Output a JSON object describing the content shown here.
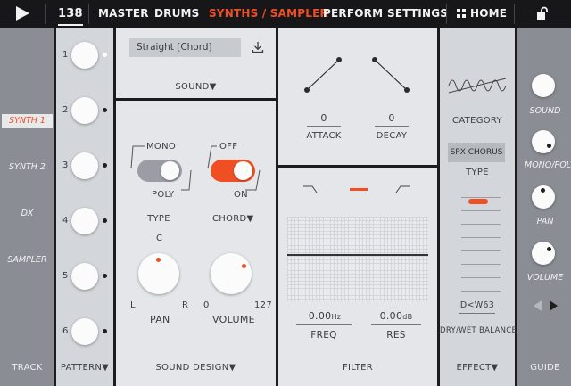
{
  "topbar": {
    "tempo": "138",
    "tabs": [
      "MASTER",
      "DRUMS",
      "SYNTHS / SAMPLER",
      "PERFORM",
      "SETTINGS"
    ],
    "home": "HOME",
    "active_tab": "SYNTHS / SAMPLER"
  },
  "track": {
    "items": [
      "SYNTH 1",
      "SYNTH 2",
      "DX",
      "SAMPLER"
    ],
    "footer": "TRACK"
  },
  "pattern": {
    "numbers": [
      "1",
      "2",
      "3",
      "4",
      "5",
      "6"
    ],
    "footer": "PATTERN▼"
  },
  "sound": {
    "preset": "Straight [Chord]",
    "label": "SOUND▼"
  },
  "sound_design": {
    "type_on": "MONO",
    "type_off": "POLY",
    "type_label": "TYPE",
    "chord_off": "OFF",
    "chord_on": "ON",
    "chord_label": "CHORD▼",
    "pan_top": "C",
    "pan_left": "L",
    "pan_right": "R",
    "pan_label": "PAN",
    "vol_min": "0",
    "vol_max": "127",
    "vol_label": "VOLUME",
    "footer": "SOUND DESIGN▼"
  },
  "envelope": {
    "attack_value": "0",
    "attack_label": "ATTACK",
    "decay_value": "0",
    "decay_label": "DECAY"
  },
  "filter": {
    "freq_value": "0.00",
    "freq_unit": "Hz",
    "freq_label": "FREQ",
    "res_value": "0.00",
    "res_unit": "dB",
    "res_label": "RES",
    "footer": "FILTER"
  },
  "effect": {
    "category_label": "CATEGORY",
    "type_value": "SPX CHORUS",
    "type_label": "TYPE",
    "balance_value": "D<W63",
    "balance_label": "DRY/WET BALANCE",
    "footer": "EFFECT▼"
  },
  "guide": {
    "items": [
      "SOUND",
      "MONO/POLY",
      "PAN",
      "VOLUME"
    ],
    "footer": "GUIDE"
  },
  "colors": {
    "accent": "#f04e23",
    "topbar_bg": "#17171a",
    "panel_dark": "#8a8e94",
    "panel_light": "#e4e6e9"
  },
  "icons": [
    "play-icon",
    "home-grid-icon",
    "unlock-icon",
    "download-icon",
    "sine-wave-icon",
    "triangle-left-icon",
    "triangle-right-icon"
  ]
}
